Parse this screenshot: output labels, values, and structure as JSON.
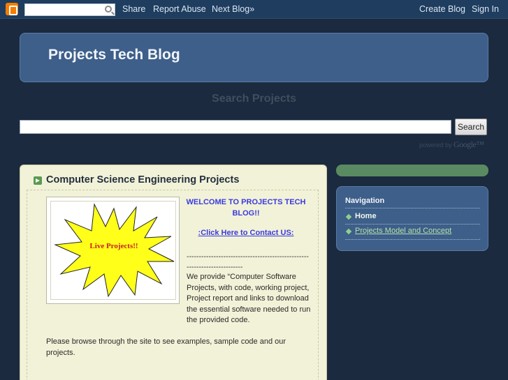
{
  "navbar": {
    "share": "Share",
    "report_abuse": "Report Abuse",
    "next_blog": "Next Blog»",
    "create_blog": "Create Blog",
    "sign_in": "Sign In"
  },
  "header": {
    "title": "Projects Tech Blog"
  },
  "search": {
    "heading": "Search Projects",
    "button": "Search",
    "powered_by": "powered by",
    "google": "Google™"
  },
  "post": {
    "title": "Computer Science Engineering Projects",
    "image_text": "Live Projects!!",
    "welcome": "WELCOME TO PROJECTS TECH BLOG!!",
    "contact": ":Click Here to Contact US: ",
    "dashes": "-------------------------------------------------------------------------",
    "intro": "We provide “Computer Software Projects, with code, working project, Project report and links to download the essential software needed to run the provided code.",
    "browse": "Please browse through the site to see examples, sample code and our projects."
  },
  "sidebar": {
    "heading": "Navigation",
    "items": [
      {
        "label": "Home"
      },
      {
        "label": "Projects Model and Concept"
      }
    ]
  },
  "colors": {
    "background": "#1b2a3e",
    "header": "#3d5f8a",
    "post_background": "#f2f2d8",
    "accent_green": "#5a8a62",
    "link_blue": "#3a3ae0"
  }
}
